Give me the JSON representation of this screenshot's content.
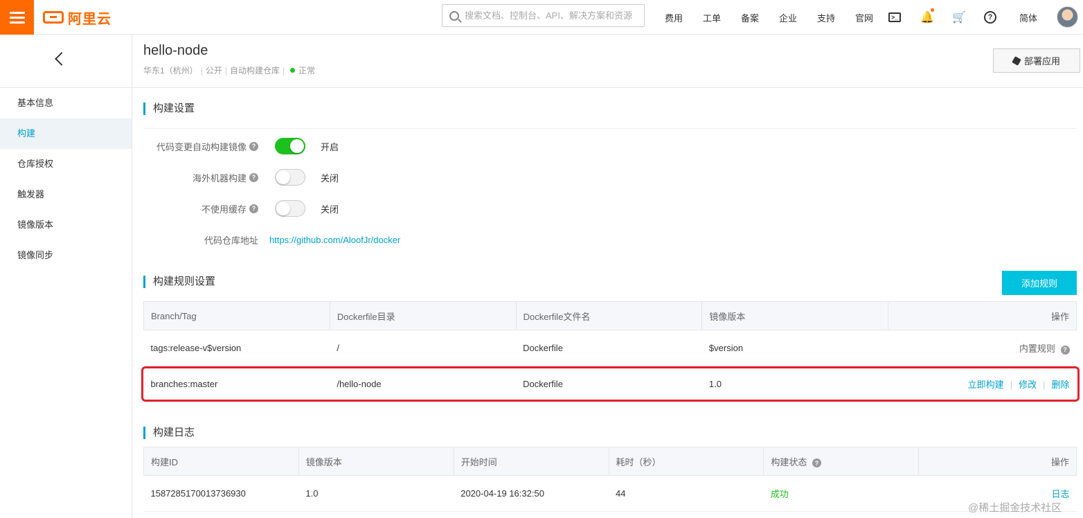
{
  "topbar": {
    "logo_text": "阿里云",
    "search_placeholder": "搜索文档、控制台、API、解决方案和资源",
    "nav_links": [
      "费用",
      "工单",
      "备案",
      "企业",
      "支持",
      "官网"
    ],
    "language": "简体"
  },
  "sidebar": {
    "items": [
      {
        "label": "基本信息"
      },
      {
        "label": "构建"
      },
      {
        "label": "仓库授权"
      },
      {
        "label": "触发器"
      },
      {
        "label": "镜像版本"
      },
      {
        "label": "镜像同步"
      }
    ]
  },
  "header": {
    "title": "hello-node",
    "region": "华东1（杭州）",
    "visibility": "公开",
    "repo_type": "自动构建仓库",
    "status": "正常",
    "deploy_label": "部署应用"
  },
  "build_settings": {
    "section_title": "构建设置",
    "auto_build_label": "代码变更自动构建镜像",
    "auto_build_state": "开启",
    "overseas_label": "海外机器构建",
    "overseas_state": "关闭",
    "no_cache_label": "不使用缓存",
    "no_cache_state": "关闭",
    "repo_url_label": "代码仓库地址",
    "repo_url": "https://github.com/AloofJr/docker"
  },
  "build_rules": {
    "section_title": "构建规则设置",
    "add_rule_label": "添加规则",
    "headers": [
      "Branch/Tag",
      "Dockerfile目录",
      "Dockerfile文件名",
      "镜像版本",
      "操作"
    ],
    "rows": [
      {
        "branch": "tags:release-v$version",
        "dir": "/",
        "file": "Dockerfile",
        "version": "$version",
        "builtin": "内置规则"
      },
      {
        "branch": "branches:master",
        "dir": "/hello-node",
        "file": "Dockerfile",
        "version": "1.0",
        "build_now": "立即构建",
        "edit": "修改",
        "delete": "删除"
      }
    ]
  },
  "build_log": {
    "section_title": "构建日志",
    "headers": [
      "构建ID",
      "镜像版本",
      "开始时间",
      "耗时（秒）",
      "构建状态",
      "操作"
    ],
    "rows": [
      {
        "id": "1587285170013736930",
        "version": "1.0",
        "start": "2020-04-19 16:32:50",
        "duration": "44",
        "status": "成功",
        "action": "日志"
      }
    ]
  },
  "watermark": "@稀土掘金技术社区",
  "colors": {
    "accent": "#00a2ca",
    "brand": "#ff6a00",
    "success": "#1dc11d",
    "highlight": "#e2212b"
  }
}
